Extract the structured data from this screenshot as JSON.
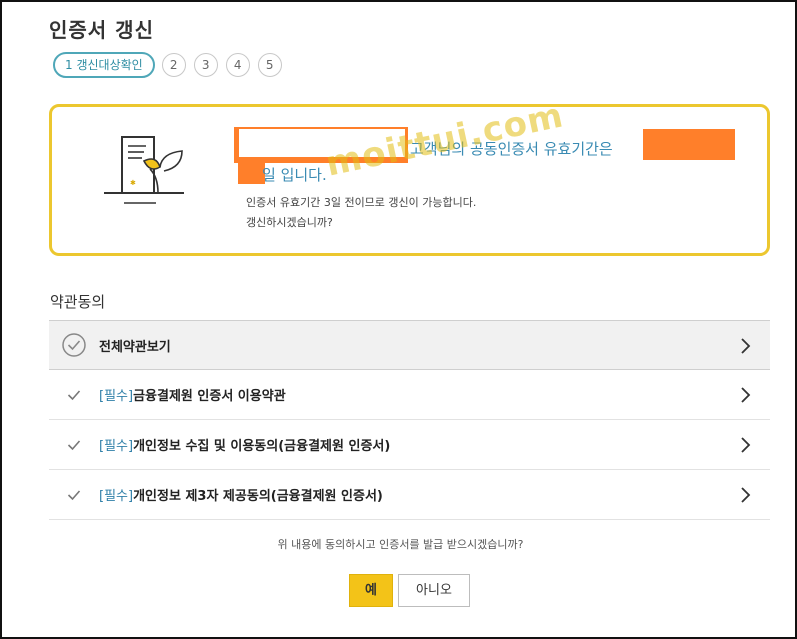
{
  "page": {
    "title": "인증서 갱신"
  },
  "steps": {
    "active_label": "1 갱신대상확인",
    "others": [
      "2",
      "3",
      "4",
      "5"
    ]
  },
  "notice": {
    "main_line_1": "고객님의 공동인증서 유효기간은",
    "main_line_2": "일 입니다.",
    "sub_line_1": "인증서 유효기간 3일 전이므로 갱신이 가능합니다.",
    "sub_line_2": "갱신하시겠습니까?",
    "watermark": "moittui.com"
  },
  "terms": {
    "heading": "약관동의",
    "view_all_label": "전체약관보기",
    "required_tag": "[필수]",
    "items": [
      {
        "label": "금융결제원 인증서 이용약관"
      },
      {
        "label": "개인정보 수집 및 이용동의(금융결제원 인증서)"
      },
      {
        "label": "개인정보 제3자 제공동의(금융결제원 인증서)"
      }
    ]
  },
  "confirm": {
    "question": "위 내용에 동의하시고 인증서를 발급 받으시겠습니까?",
    "yes_label": "예",
    "no_label": "아니오"
  },
  "colors": {
    "accent_yellow": "#ecc72f",
    "link_blue": "#3a8bb3",
    "redaction_orange": "#ff7f2a",
    "step_teal": "#4fa7b8"
  },
  "icons": {
    "certificate": "certificate-leaf-icon",
    "check_circle": "check-circle-icon",
    "check": "check-icon",
    "chevron": "chevron-right-icon"
  }
}
